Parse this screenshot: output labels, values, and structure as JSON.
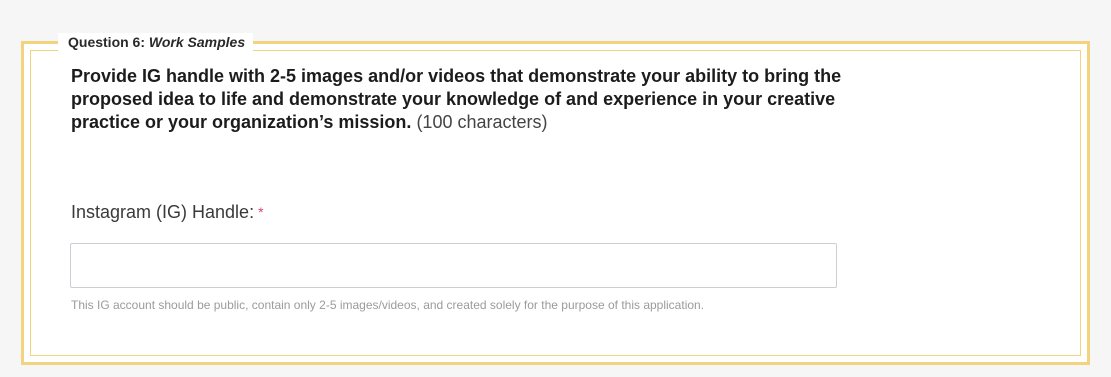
{
  "section": {
    "legend_prefix": "Question 6:",
    "legend_title": "Work Samples",
    "question_bold": "Provide IG handle with 2-5 images and/or videos that demonstrate your ability to bring the proposed idea to life and demonstrate your knowledge of and experience in your creative practice or your organization’s mission.",
    "question_note": "(100 characters)"
  },
  "field": {
    "label": "Instagram (IG) Handle:",
    "required_mark": "*",
    "value": "",
    "placeholder": "",
    "help_text": "This IG account should be public, contain only 2-5 images/videos, and created solely for the purpose of this application."
  },
  "colors": {
    "border_accent": "#f2d37e",
    "required": "#d6457a"
  }
}
